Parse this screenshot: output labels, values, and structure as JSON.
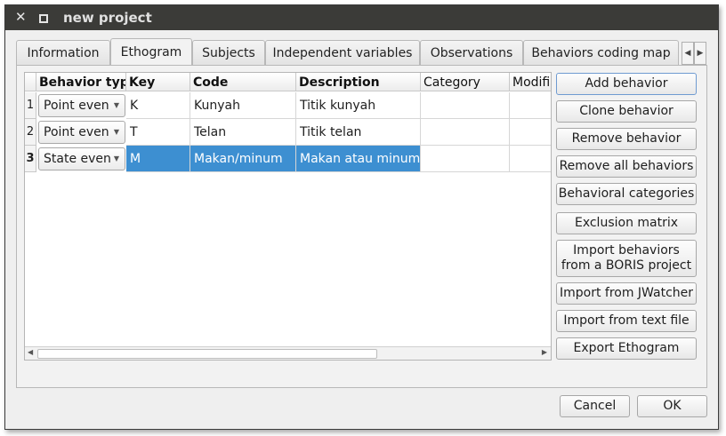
{
  "window": {
    "title": "new project"
  },
  "tabs": [
    "Information",
    "Ethogram",
    "Subjects",
    "Independent variables",
    "Observations",
    "Behaviors coding map"
  ],
  "table": {
    "headers": [
      "Behavior type",
      "Key",
      "Code",
      "Description",
      "Category",
      "Modifi"
    ],
    "rows": [
      {
        "num": "1",
        "type": "Point even",
        "key": "K",
        "code": "Kunyah",
        "description": "Titik kunyah",
        "category": "",
        "modifiers": ""
      },
      {
        "num": "2",
        "type": "Point even",
        "key": "T",
        "code": "Telan",
        "description": "Titik telan",
        "category": "",
        "modifiers": ""
      },
      {
        "num": "3",
        "type": "State even",
        "key": "M",
        "code": "Makan/minum",
        "description": "Makan atau minum",
        "category": "",
        "modifiers": ""
      }
    ]
  },
  "buttons": {
    "add": "Add behavior",
    "clone": "Clone behavior",
    "remove": "Remove behavior",
    "remove_all": "Remove all behaviors",
    "categories": "Behavioral categories",
    "exclusion": "Exclusion matrix",
    "import_boris_1": "Import behaviors",
    "import_boris_2": "from a BORIS project",
    "import_jwatcher": "Import from JWatcher",
    "import_text": "Import from text file",
    "export": "Export Ethogram",
    "cancel": "Cancel",
    "ok": "OK"
  },
  "colors": {
    "selection": "#3d8fd1",
    "titlebar": "#3b3b38"
  },
  "icons": {
    "close": "close-icon",
    "maximize": "maximize-icon",
    "dropdown": "chevron-down-icon"
  }
}
